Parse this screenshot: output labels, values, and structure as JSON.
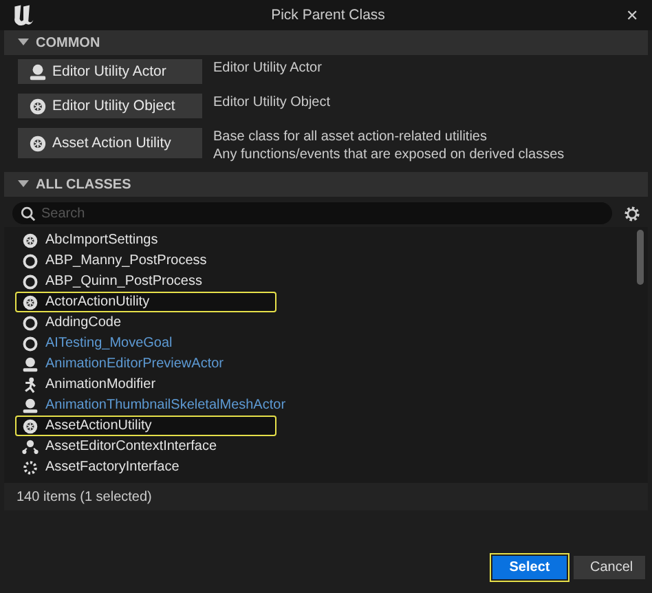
{
  "window": {
    "title": "Pick Parent Class",
    "close": "✕"
  },
  "common": {
    "title": "COMMON",
    "expanded": true,
    "items": [
      {
        "label": "Editor Utility Actor",
        "kind": "actor",
        "description": [
          "Editor Utility Actor"
        ]
      },
      {
        "label": "Editor Utility Object",
        "kind": "object",
        "description": [
          "Editor Utility Object"
        ]
      },
      {
        "label": "Asset Action Utility",
        "kind": "object",
        "description": [
          "Base class for all asset action-related utilities",
          "Any functions/events that are exposed on derived classes"
        ]
      }
    ]
  },
  "all_classes": {
    "title": "ALL CLASSES",
    "expanded": true,
    "search": {
      "placeholder": "Search"
    },
    "items": [
      {
        "name": "AbcImportSettings",
        "kind": "object",
        "blueprint": false,
        "highlighted": false
      },
      {
        "name": "ABP_Manny_PostProcess",
        "kind": "circle",
        "blueprint": false,
        "highlighted": false
      },
      {
        "name": "ABP_Quinn_PostProcess",
        "kind": "circle",
        "blueprint": false,
        "highlighted": false
      },
      {
        "name": "ActorActionUtility",
        "kind": "object",
        "blueprint": false,
        "highlighted": true
      },
      {
        "name": "AddingCode",
        "kind": "circle",
        "blueprint": false,
        "highlighted": false
      },
      {
        "name": "AITesting_MoveGoal",
        "kind": "circle",
        "blueprint": true,
        "highlighted": false
      },
      {
        "name": "AnimationEditorPreviewActor",
        "kind": "actor",
        "blueprint": true,
        "highlighted": false
      },
      {
        "name": "AnimationModifier",
        "kind": "modifier",
        "blueprint": false,
        "highlighted": false
      },
      {
        "name": "AnimationThumbnailSkeletalMeshActor",
        "kind": "actor",
        "blueprint": true,
        "highlighted": false
      },
      {
        "name": "AssetActionUtility",
        "kind": "object",
        "blueprint": false,
        "highlighted": true
      },
      {
        "name": "AssetEditorContextInterface",
        "kind": "interface",
        "blueprint": false,
        "highlighted": false
      },
      {
        "name": "AssetFactoryInterface",
        "kind": "gear",
        "blueprint": false,
        "highlighted": false
      }
    ],
    "status": "140 items (1 selected)"
  },
  "buttons": [
    {
      "label": "Select",
      "kind": "primary"
    },
    {
      "label": "Cancel",
      "kind": "secondary"
    }
  ]
}
